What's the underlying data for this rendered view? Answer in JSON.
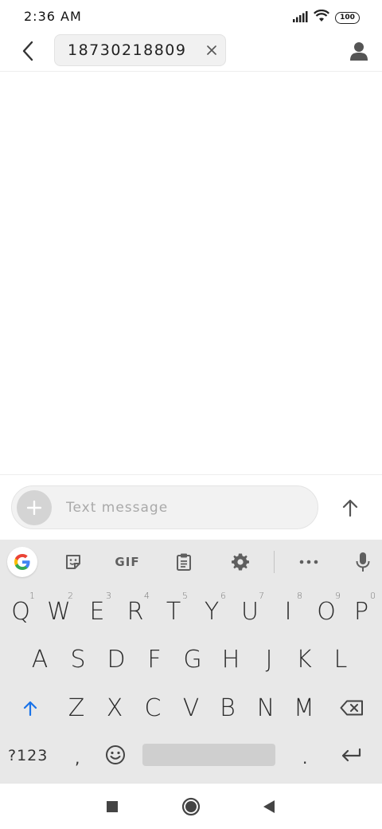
{
  "status_bar": {
    "time": "2:36 AM",
    "battery": "100",
    "icons": [
      "signal-icon",
      "wifi-icon",
      "battery-icon"
    ]
  },
  "header": {
    "recipient": "18730218809",
    "back_icon": "back-arrow-icon",
    "close_icon": "close-icon",
    "contact_icon": "person-icon"
  },
  "compose": {
    "placeholder": "Text message",
    "value": "",
    "add_icon": "plus-icon",
    "send_icon": "send-arrow-icon"
  },
  "keyboard": {
    "toolbar": {
      "gif_label": "GIF",
      "items": [
        "google-icon",
        "sticker-icon",
        "gif",
        "clipboard-icon",
        "settings-icon",
        "more-icon",
        "mic-icon"
      ]
    },
    "rows": [
      [
        "Q",
        "W",
        "E",
        "R",
        "T",
        "Y",
        "U",
        "I",
        "O",
        "P"
      ],
      [
        "A",
        "S",
        "D",
        "F",
        "G",
        "H",
        "J",
        "K",
        "L"
      ],
      [
        "Z",
        "X",
        "C",
        "V",
        "B",
        "N",
        "M"
      ]
    ],
    "number_hints": [
      "1",
      "2",
      "3",
      "4",
      "5",
      "6",
      "7",
      "8",
      "9",
      "0"
    ],
    "symbols_label": "?123",
    "comma": ",",
    "period": ".",
    "accent_color": "#1a73e8"
  },
  "nav_bar": {
    "icons": [
      "recent-apps-icon",
      "home-icon",
      "back-icon"
    ]
  }
}
